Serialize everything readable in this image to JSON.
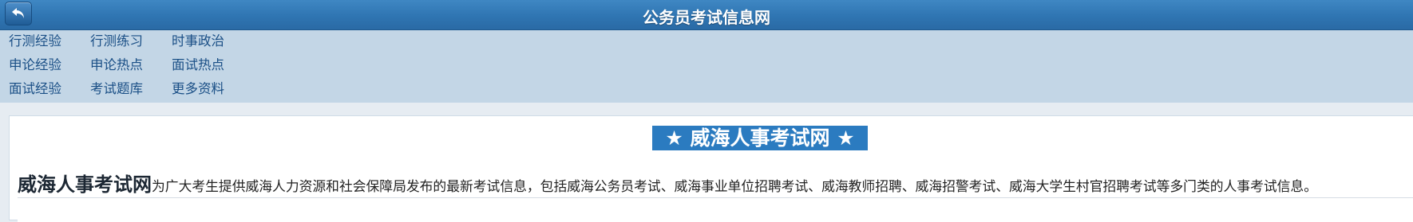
{
  "header": {
    "title": "公务员考试信息网",
    "back_icon": "back-arrow-icon"
  },
  "nav": {
    "rows": [
      [
        "行测经验",
        "行测练习",
        "时事政治"
      ],
      [
        "申论经验",
        "申论热点",
        "面试热点"
      ],
      [
        "面试经验",
        "考试题库",
        "更多资料"
      ]
    ]
  },
  "main": {
    "heading": "★ 威海人事考试网 ★",
    "desc_strong": "威海人事考试网",
    "desc_text": "为广大考生提供威海人力资源和社会保障局发布的最新考试信息，包括威海公务员考试、威海事业单位招聘考试、威海教师招聘、威海招警考试、威海大学生村官招聘考试等多门类的人事考试信息。"
  },
  "colors": {
    "header_bg": "#3479b6",
    "nav_bg": "#c3d6e6",
    "nav_link": "#1a4f86",
    "heading_bg": "#2b7bc0"
  }
}
